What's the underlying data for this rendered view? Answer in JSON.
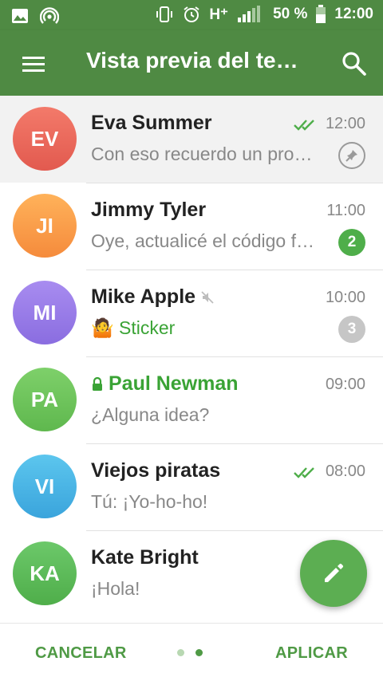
{
  "statusbar": {
    "network": "H⁺",
    "battery": "50 %",
    "time": "12:00"
  },
  "appbar": {
    "title": "Vista previa del te…"
  },
  "chats": [
    {
      "initials": "EV",
      "name": "Eva Summer",
      "time": "12:00",
      "preview": "Con eso recuerdo un pro…",
      "read_checks": true,
      "pinned": true,
      "color_top": "#f37a6a",
      "color_bottom": "#e25a4f"
    },
    {
      "initials": "JI",
      "name": "Jimmy Tyler",
      "time": "11:00",
      "preview": "Oye, actualicé el código f…",
      "unread": "2",
      "badge_color": "#4fae4a",
      "color_top": "#ffb25a",
      "color_bottom": "#f58b3c"
    },
    {
      "initials": "MI",
      "name": "Mike Apple",
      "time": "10:00",
      "preview_media": "Sticker",
      "muted": true,
      "unread": "3",
      "badge_color": "#c6c6c6",
      "color_top": "#a88cf0",
      "color_bottom": "#8a6de0"
    },
    {
      "initials": "PA",
      "name": "Paul Newman",
      "time": "09:00",
      "preview": "¿Alguna idea?",
      "secret": true,
      "color_top": "#7ed06a",
      "color_bottom": "#5fb84e"
    },
    {
      "initials": "VI",
      "name": "Viejos piratas",
      "time": "08:00",
      "preview": "Tú: ¡Yo-ho-ho!",
      "read_checks": true,
      "color_top": "#5cc6ee",
      "color_bottom": "#3aa4dc"
    },
    {
      "initials": "KA",
      "name": "Kate Bright",
      "time": "",
      "preview": "¡Hola!",
      "color_top": "#6cc86a",
      "color_bottom": "#4fae4a"
    }
  ],
  "footer": {
    "cancel": "CANCELAR",
    "apply": "APLICAR"
  },
  "colors": {
    "primary": "#4f8a43",
    "accent": "#5cae52"
  },
  "icons": [
    "gallery-icon",
    "hotspot-icon",
    "vibrate-icon",
    "alarm-icon",
    "signal-icon",
    "battery-icon",
    "menu-icon",
    "search-icon",
    "double-check-icon",
    "pin-icon",
    "mute-icon",
    "lock-icon",
    "pencil-icon"
  ]
}
